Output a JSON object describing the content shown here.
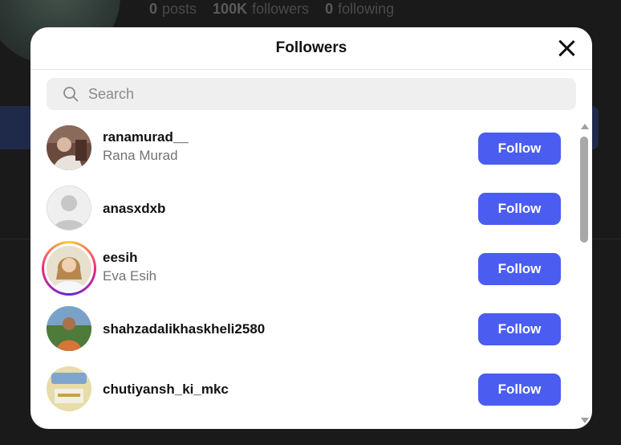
{
  "background": {
    "stats": [
      {
        "value": "0",
        "label": "posts"
      },
      {
        "value": "100K",
        "label": "followers"
      },
      {
        "value": "0",
        "label": "following"
      }
    ]
  },
  "modal": {
    "title": "Followers",
    "close_icon": "close-icon",
    "search": {
      "placeholder": "Search",
      "value": "",
      "icon": "search-icon"
    },
    "followers": [
      {
        "username": "ranamurad__",
        "full_name": "Rana Murad",
        "button": "Follow",
        "has_story": false
      },
      {
        "username": "anasxdxb",
        "full_name": "",
        "button": "Follow",
        "has_story": false
      },
      {
        "username": "eesih",
        "full_name": "Eva Esih",
        "button": "Follow",
        "has_story": true
      },
      {
        "username": "shahzadalikhaskheli2580",
        "full_name": "",
        "button": "Follow",
        "has_story": false
      },
      {
        "username": "chutiyansh_ki_mkc",
        "full_name": "",
        "button": "Follow",
        "has_story": false
      }
    ]
  },
  "colors": {
    "follow_button": "#4a5df0",
    "secondary_text": "#737373",
    "search_background": "#efefef"
  }
}
